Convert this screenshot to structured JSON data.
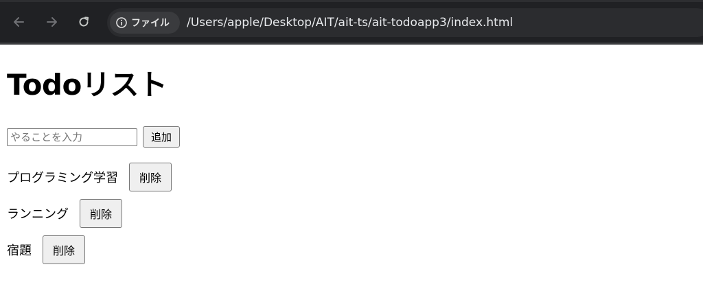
{
  "browser": {
    "chip_label": "ファイル",
    "url": "/Users/apple/Desktop/AIT/ait-ts/ait-todoapp3/index.html",
    "icons": {
      "back": "arrow-left-icon",
      "forward": "arrow-right-icon",
      "reload": "reload-icon",
      "info": "info-circle-icon"
    }
  },
  "page": {
    "title": "Todoリスト",
    "input_placeholder": "やることを入力",
    "add_label": "追加",
    "todos": [
      {
        "text": "プログラミング学習",
        "delete_label": "削除"
      },
      {
        "text": "ランニング",
        "delete_label": "削除"
      },
      {
        "text": "宿題",
        "delete_label": "削除"
      }
    ]
  }
}
